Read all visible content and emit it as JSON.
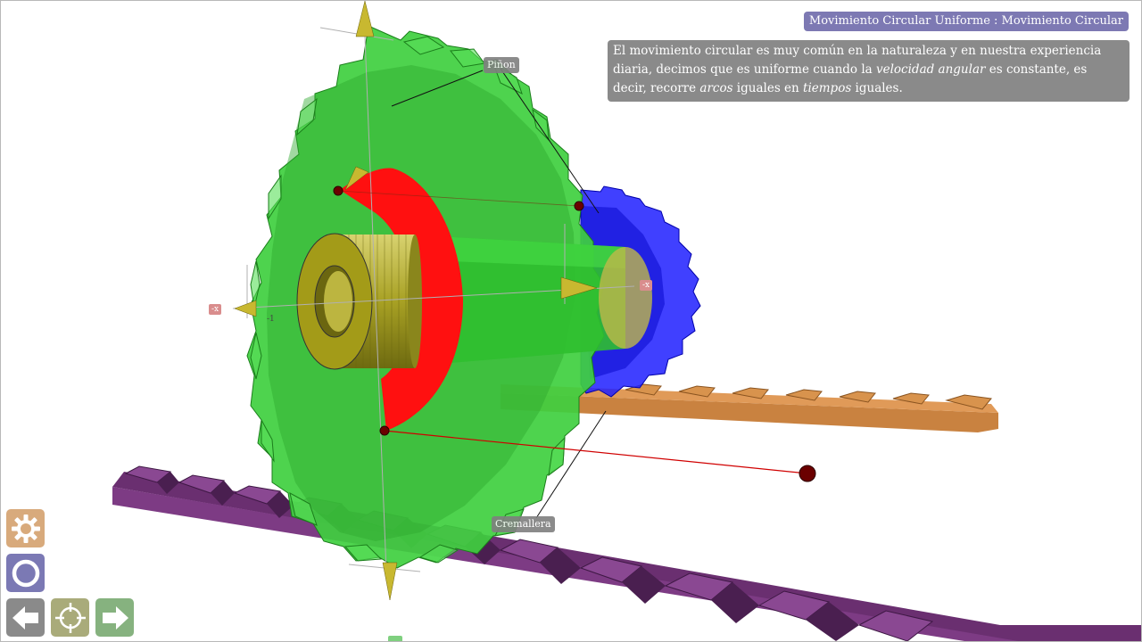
{
  "header": {
    "title": "Movimiento Circular Uniforme : Movimiento Circular"
  },
  "description": {
    "part1": "El movimiento circular es muy común en la naturaleza y en nuestra experiencia diaria, decimos que es uniforme cuando la ",
    "em1": "velocidad angular",
    "part2": " es constante, es decir, recorre ",
    "em2": "arcos",
    "part3": " iguales en ",
    "em3": "tiempos",
    "part4": " iguales."
  },
  "scene": {
    "label_pinon": "Piñon",
    "label_cremallera": "Cremallera",
    "axis_x_neg": "-x",
    "axis_x_pos": "-x",
    "axis_tick": "-1"
  },
  "toolbar": {
    "settings_icon": "gear-icon",
    "view_icon": "circle-icon",
    "prev_icon": "arrow-left-icon",
    "center_icon": "target-icon",
    "next_icon": "arrow-right-icon"
  },
  "colors": {
    "gear_large": "#3fcf3f",
    "gear_small": "#1a1aff",
    "disk": "#ff0000",
    "shaft": "#9c9a1a",
    "rack_orange": "#c98240",
    "rack_purple": "#7d3b84",
    "title_bg": "#7d79b3",
    "desc_bg": "#8a8a8a",
    "btn_settings": "#d8aa7c",
    "btn_view": "#7b79b4",
    "btn_prev": "#8a8a8a",
    "btn_center": "#a9ab7a",
    "btn_next": "#86b27f"
  }
}
